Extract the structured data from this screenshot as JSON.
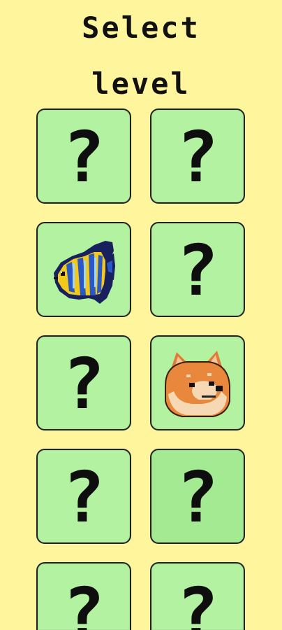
{
  "title": {
    "line1": "Select",
    "line2": "level"
  },
  "colors": {
    "background": "#fff59d",
    "tile": "#b3f2a1",
    "tile_pressed": "#a4ea92",
    "border": "#222222"
  },
  "levels": [
    {
      "state": "locked",
      "label": "?"
    },
    {
      "state": "locked",
      "label": "?"
    },
    {
      "state": "unlocked",
      "icon": "fish-icon"
    },
    {
      "state": "locked",
      "label": "?"
    },
    {
      "state": "locked",
      "label": "?"
    },
    {
      "state": "unlocked",
      "icon": "doge-icon"
    },
    {
      "state": "locked",
      "label": "?"
    },
    {
      "state": "locked",
      "label": "?"
    },
    {
      "state": "locked",
      "label": "?"
    },
    {
      "state": "locked",
      "label": "?"
    }
  ]
}
